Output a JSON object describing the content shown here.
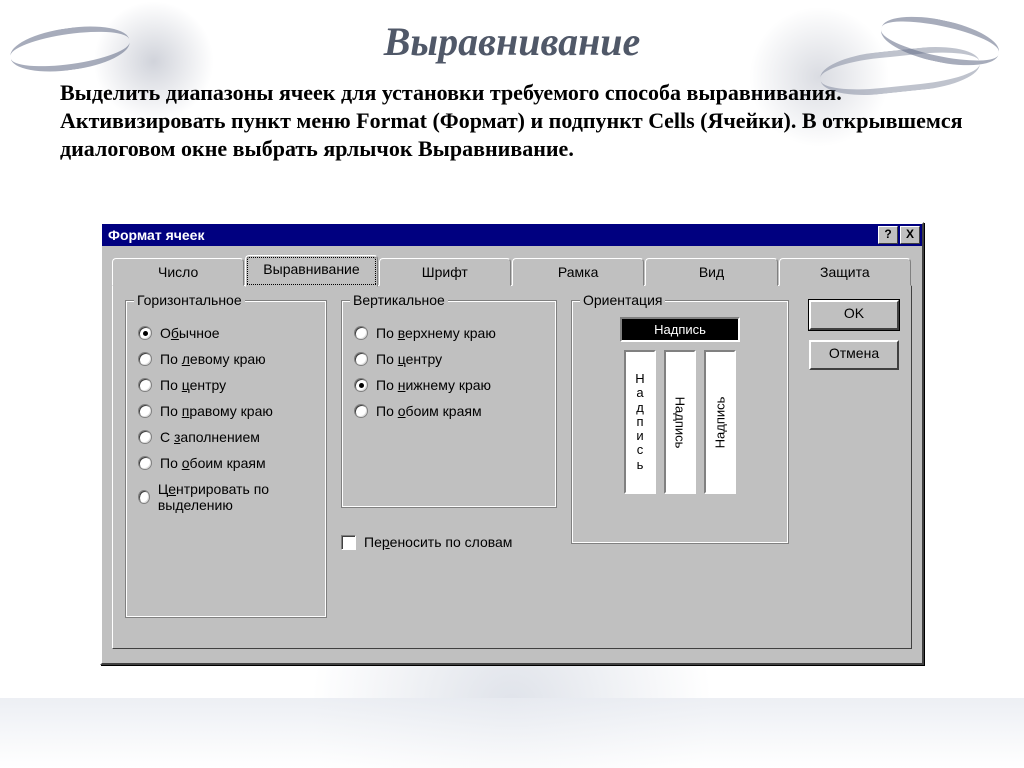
{
  "slide": {
    "title": "Выравнивание",
    "intro": "Выделить диапазоны ячеек для установки требуемого способа выравнивания. Активизировать пункт меню Format (Формат) и подпункт Cells (Ячейки). В открывшемся диалоговом окне выбрать ярлычок Выравнивание."
  },
  "dialog": {
    "title": "Формат ячеек",
    "help_symbol": "?",
    "close_symbol": "X",
    "tabs": [
      {
        "label": "Число",
        "active": false
      },
      {
        "label": "Выравнивание",
        "active": true
      },
      {
        "label": "Шрифт",
        "active": false
      },
      {
        "label": "Рамка",
        "active": false
      },
      {
        "label": "Вид",
        "active": false
      },
      {
        "label": "Защита",
        "active": false
      }
    ],
    "horizontal": {
      "legend": "Горизонтальное",
      "options": [
        {
          "pre": "О",
          "u": "б",
          "post": "ычное",
          "selected": true
        },
        {
          "pre": "По ",
          "u": "л",
          "post": "евому краю",
          "selected": false
        },
        {
          "pre": "По ",
          "u": "ц",
          "post": "ентру",
          "selected": false
        },
        {
          "pre": "По ",
          "u": "п",
          "post": "равому краю",
          "selected": false
        },
        {
          "pre": "С ",
          "u": "з",
          "post": "аполнением",
          "selected": false
        },
        {
          "pre": "По ",
          "u": "о",
          "post": "боим краям",
          "selected": false
        },
        {
          "pre": "Ц",
          "u": "е",
          "post": "нтрировать по выделению",
          "selected": false
        }
      ]
    },
    "vertical": {
      "legend": "Вертикальное",
      "options": [
        {
          "pre": "По ",
          "u": "в",
          "post": "ерхнему краю",
          "selected": false
        },
        {
          "pre": "По ",
          "u": "ц",
          "post": "ентру",
          "selected": false
        },
        {
          "pre": "По ",
          "u": "н",
          "post": "ижнему краю",
          "selected": true
        },
        {
          "pre": "По ",
          "u": "о",
          "post": "боим краям",
          "selected": false
        }
      ]
    },
    "orientation": {
      "legend": "Ориентация",
      "top_label": "Надпись",
      "stack_label": "Н\nа\nд\nп\nи\nс\nь",
      "rot_label": "Надпись"
    },
    "wrap": {
      "pre": "Пе",
      "u": "р",
      "post": "еносить по словам",
      "checked": false
    },
    "buttons": {
      "ok": "OK",
      "cancel": "Отмена"
    }
  }
}
